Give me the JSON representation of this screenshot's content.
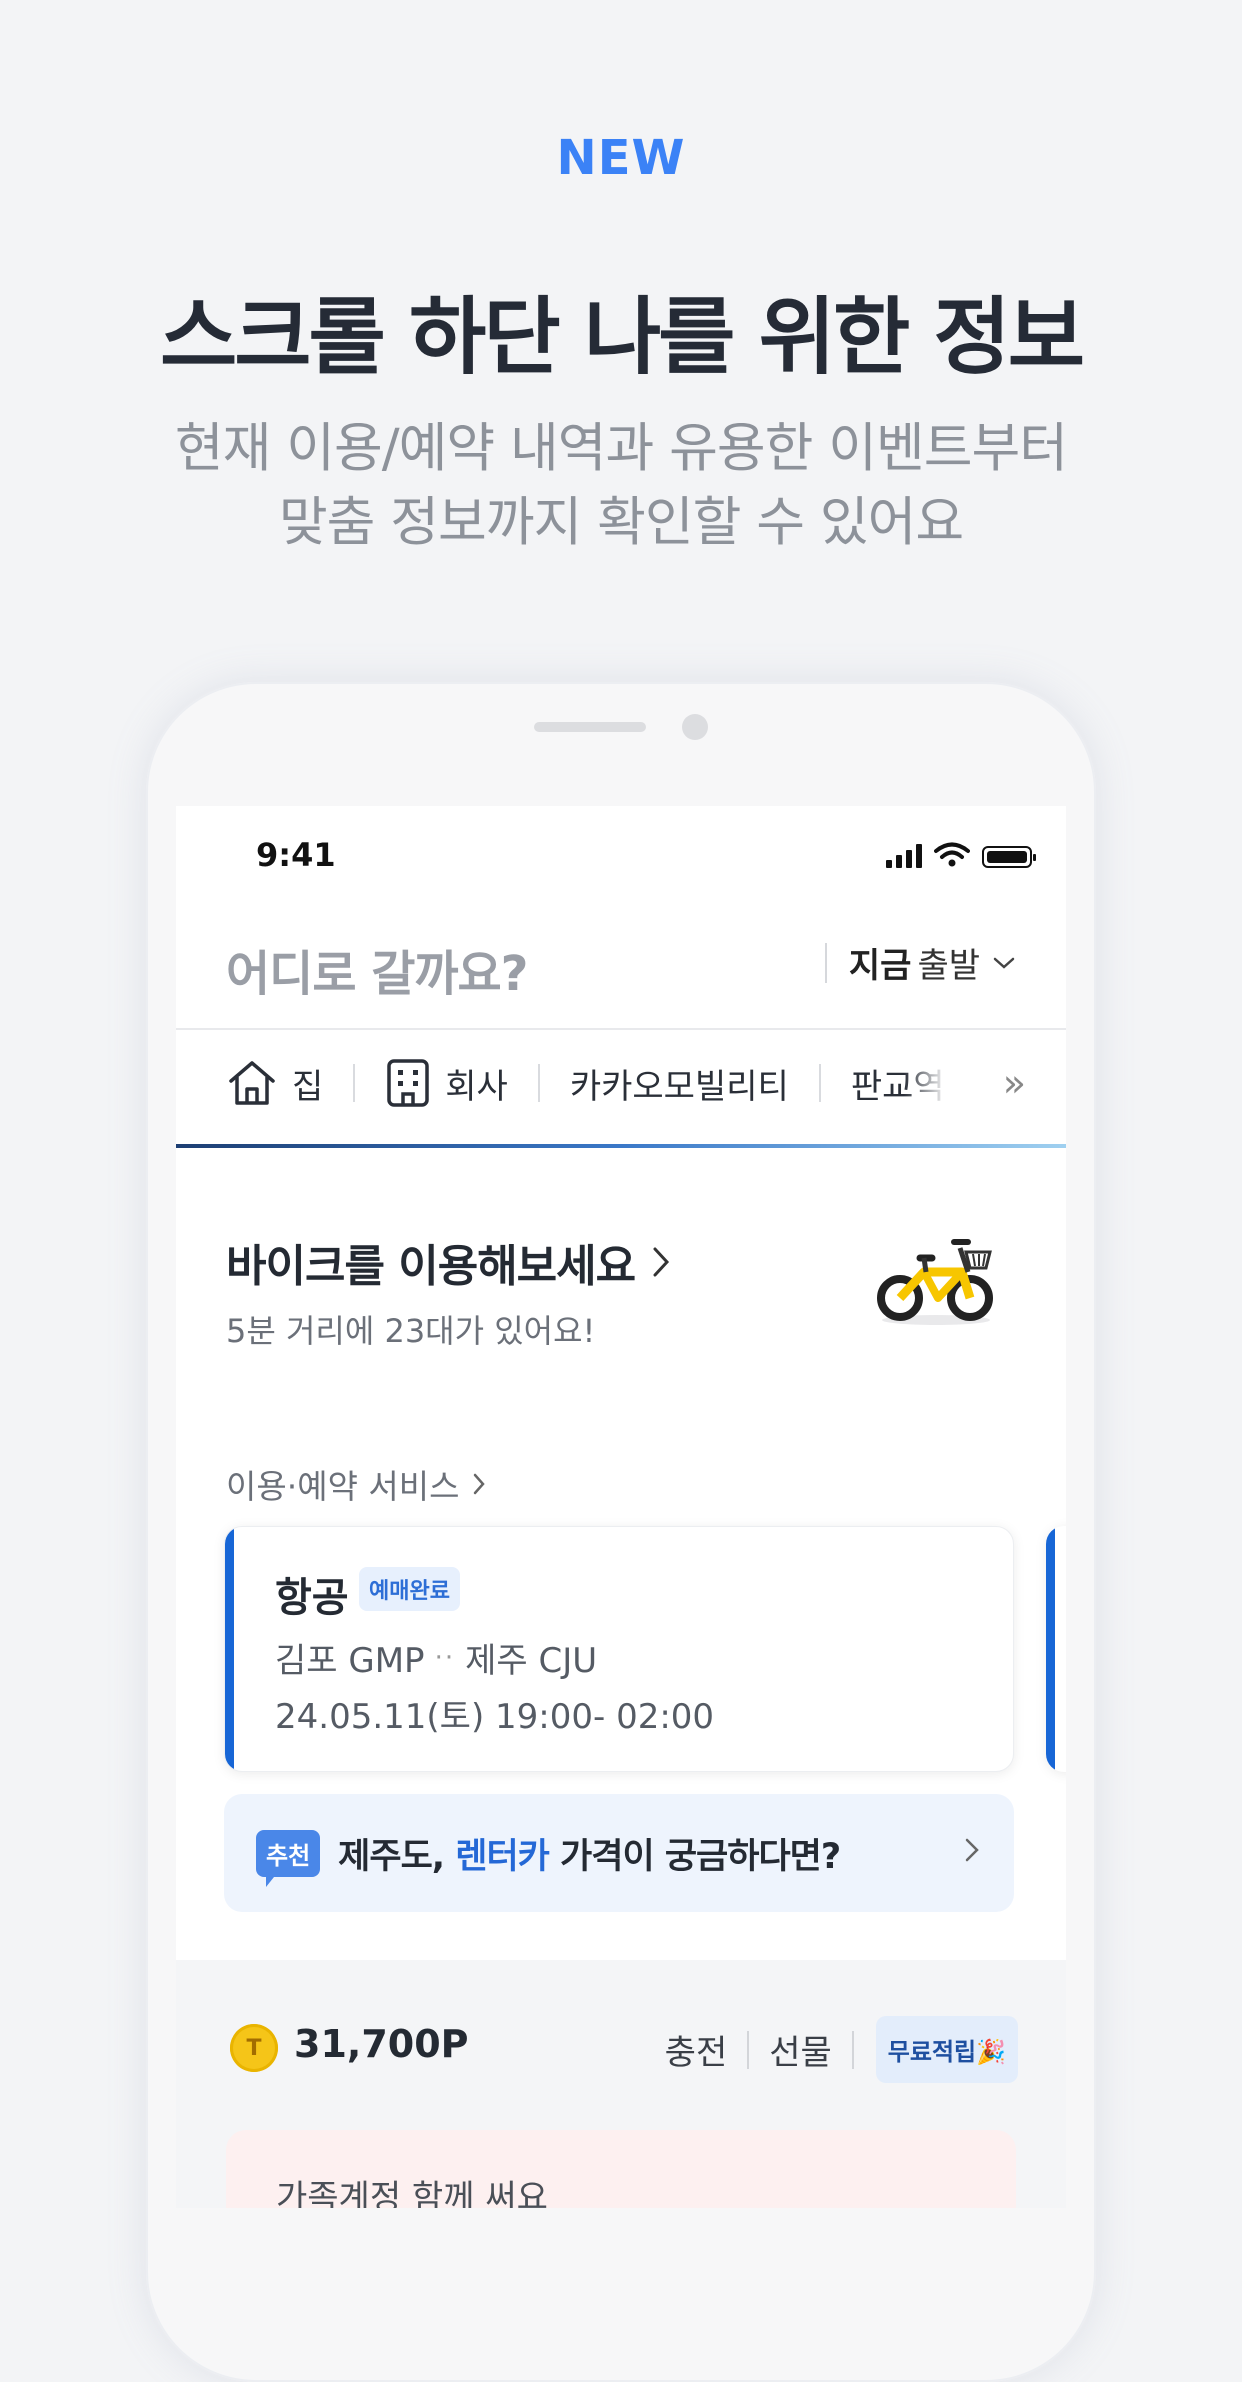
{
  "hero": {
    "badge": "NEW",
    "title": "스크롤 하단 나를 위한 정보",
    "subtitle_line1": "현재 이용/예약 내역과 유용한 이벤트부터",
    "subtitle_line2": "맞춤 정보까지 확인할 수 있어요"
  },
  "status_bar": {
    "time": "9:41"
  },
  "search": {
    "placeholder": "어디로 갈까요?",
    "depart_strong": "지금",
    "depart_light": "출발"
  },
  "places": [
    {
      "label": "집",
      "icon": "home-icon"
    },
    {
      "label": "회사",
      "icon": "building-icon"
    },
    {
      "label": "카카오모빌리티"
    },
    {
      "label": "판교역"
    }
  ],
  "bike": {
    "title": "바이크를 이용해보세요",
    "subtitle": "5분 거리에 23대가 있어요!"
  },
  "services": {
    "heading": "이용·예약 서비스",
    "card": {
      "title": "항공",
      "badge": "예매완료",
      "from": "김포 GMP",
      "to": "제주 CJU",
      "time": "24.05.11(토) 19:00- 02:00"
    }
  },
  "recommend": {
    "badge": "추천",
    "text_before": "제주도, ",
    "highlight": "렌터카",
    "text_after": " 가격이 궁금하다면?"
  },
  "points": {
    "coin_label": "T",
    "value": "31,700P",
    "charge": "충전",
    "gift": "선물",
    "free": "무료적립🎉"
  },
  "bottom_card": {
    "text": "가족계정 함께 써요"
  },
  "colors": {
    "accent": "#3b82f6",
    "card_accent": "#1766d6",
    "rec_bg": "#eef4fd"
  }
}
